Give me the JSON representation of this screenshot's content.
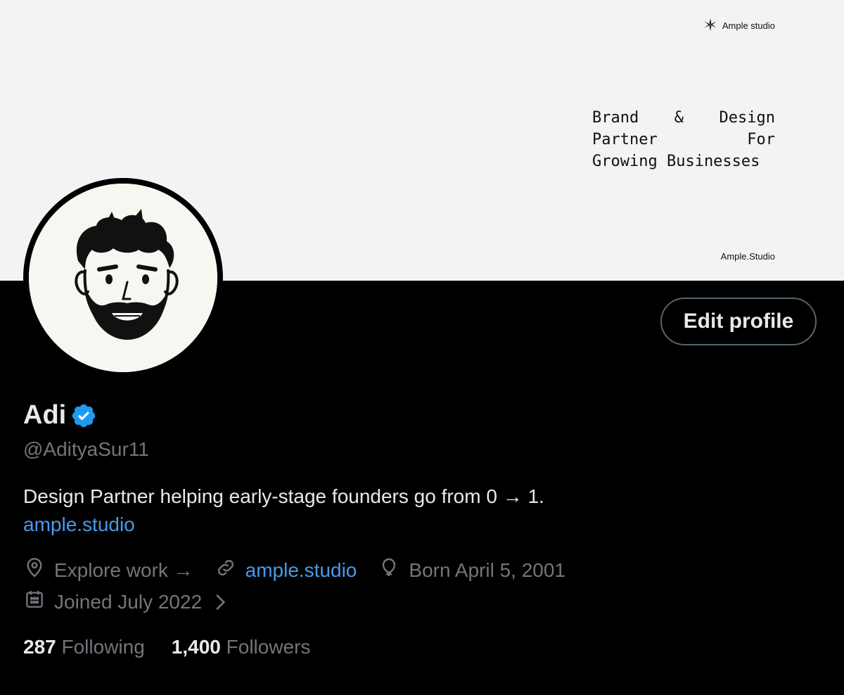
{
  "banner": {
    "brand_name": "Ample studio",
    "tagline_lines": [
      [
        "Brand",
        "&",
        "Design"
      ],
      [
        "Partner",
        "For"
      ],
      [
        "Growing Businesses"
      ]
    ],
    "domain": "Ample.Studio",
    "background": "#f3f3f3"
  },
  "profile": {
    "name": "Adi",
    "handle": "@AdityaSur11",
    "verified": true,
    "bio": "Design Partner helping early-stage founders go from 0 → 1.",
    "bio_link": "ample.studio",
    "edit_button_label": "Edit profile"
  },
  "meta": {
    "location": "Explore work →",
    "website": "ample.studio",
    "birthday": "Born April 5, 2001",
    "joined": "Joined July 2022",
    "icons": [
      "location-pin-icon",
      "link-icon",
      "balloon-icon",
      "calendar-icon",
      "chevron-right-icon"
    ]
  },
  "stats": {
    "following_count": "287",
    "following_label": "Following",
    "followers_count": "1,400",
    "followers_label": "Followers"
  },
  "colors": {
    "accent_link": "#4a99e9",
    "verified_badge": "#1d9bf0",
    "muted_text": "#71767b",
    "primary_text": "#e7e9ea"
  }
}
